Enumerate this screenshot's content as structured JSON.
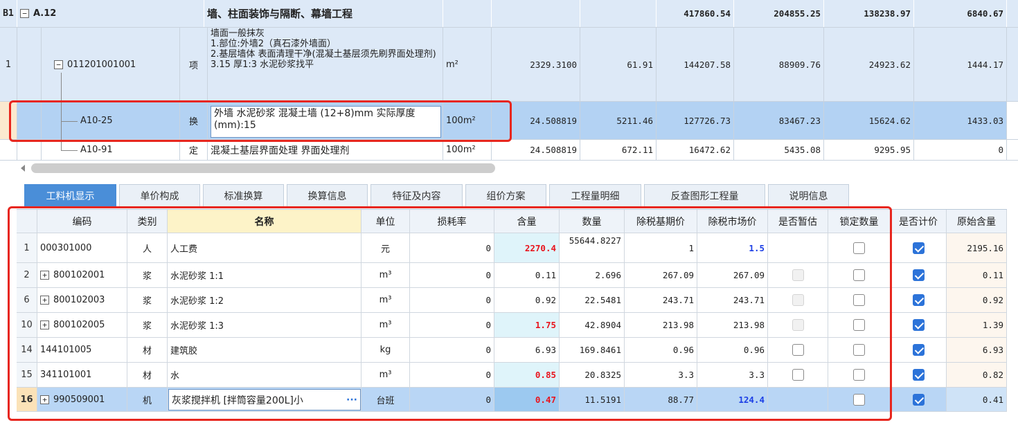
{
  "top_grid": {
    "b1": {
      "seq": "B1",
      "expander": "−",
      "code": "A.12",
      "name": "墙、柱面装饰与隔断、幕墙工程",
      "v1": "417860.54",
      "v2": "204855.25",
      "v3": "138238.97",
      "v4": "6840.67"
    },
    "r1": {
      "seq": "1",
      "expander": "−",
      "code": "011201001001",
      "type": "项",
      "name": "墙面一般抹灰\n1.部位:外墙2（真石漆外墙面）\n2.基层墙体 表面清理干净(混凝土基层须先刷界面处理剂)\n3.15 厚1:3 水泥砂浆找平",
      "unit": "m²",
      "qty": "2329.3100",
      "price": "61.91",
      "total": "144207.58",
      "v1": "88909.76",
      "v2": "24923.62",
      "v3": "1444.17"
    },
    "r2": {
      "code": "A10-25",
      "type": "换",
      "name": "外墙 水泥砂浆 混凝土墙 (12+8)mm 实际厚度(mm):15",
      "unit": "100m²",
      "qty": "24.508819",
      "price": "5211.46",
      "total": "127726.73",
      "v1": "83467.23",
      "v2": "15624.62",
      "v3": "1433.03"
    },
    "r3": {
      "code": "A10-91",
      "type": "定",
      "name": "混凝土基层界面处理 界面处理剂",
      "unit": "100m²",
      "qty": "24.508819",
      "price": "672.11",
      "total": "16472.62",
      "v1": "5435.08",
      "v2": "9295.95",
      "v3": "0"
    }
  },
  "tabs": [
    "工料机显示",
    "单价构成",
    "标准换算",
    "换算信息",
    "特征及内容",
    "组价方案",
    "工程量明细",
    "反查图形工程量",
    "说明信息"
  ],
  "bottom_grid": {
    "headers": [
      "编码",
      "类别",
      "名称",
      "单位",
      "损耗率",
      "含量",
      "数量",
      "除税基期价",
      "除税市场价",
      "是否暂估",
      "锁定数量",
      "是否计价",
      "原始含量"
    ],
    "rows": [
      {
        "rn": "1",
        "exp": "",
        "code": "000301000",
        "cat": "人",
        "name": "人工费",
        "unit": "元",
        "loss": "0",
        "content": "2270.4",
        "qty": "55644.8227",
        "base": "1",
        "market": "1.5",
        "orig": "2195.16"
      },
      {
        "rn": "2",
        "exp": "+",
        "code": "800102001",
        "cat": "浆",
        "name": "水泥砂浆 1:1",
        "unit": "m³",
        "loss": "0",
        "content": "0.11",
        "qty": "2.696",
        "base": "267.09",
        "market": "267.09",
        "orig": "0.11"
      },
      {
        "rn": "6",
        "exp": "+",
        "code": "800102003",
        "cat": "浆",
        "name": "水泥砂浆 1:2",
        "unit": "m³",
        "loss": "0",
        "content": "0.92",
        "qty": "22.5481",
        "base": "243.71",
        "market": "243.71",
        "orig": "0.92"
      },
      {
        "rn": "10",
        "exp": "+",
        "code": "800102005",
        "cat": "浆",
        "name": "水泥砂浆 1:3",
        "unit": "m³",
        "loss": "0",
        "content": "1.75",
        "qty": "42.8904",
        "base": "213.98",
        "market": "213.98",
        "orig": "1.39"
      },
      {
        "rn": "14",
        "exp": "",
        "code": "144101005",
        "cat": "材",
        "name": "建筑胶",
        "unit": "kg",
        "loss": "0",
        "content": "6.93",
        "qty": "169.8461",
        "base": "0.96",
        "market": "0.96",
        "orig": "6.93"
      },
      {
        "rn": "15",
        "exp": "",
        "code": "341101001",
        "cat": "材",
        "name": "水",
        "unit": "m³",
        "loss": "0",
        "content": "0.85",
        "qty": "20.8325",
        "base": "3.3",
        "market": "3.3",
        "orig": "0.82"
      },
      {
        "rn": "16",
        "exp": "+",
        "code": "990509001",
        "cat": "机",
        "name": "灰浆搅拌机 [拌筒容量200L]小",
        "more": "···",
        "unit": "台班",
        "loss": "0",
        "content": "0.47",
        "qty": "11.5191",
        "base": "88.77",
        "market": "124.4",
        "orig": "0.41"
      }
    ]
  },
  "colors": {
    "accent": "#4a8ed8",
    "highlight": "#e7261e",
    "changed_value": "#e8141d",
    "market_changed": "#1b3ee6"
  }
}
